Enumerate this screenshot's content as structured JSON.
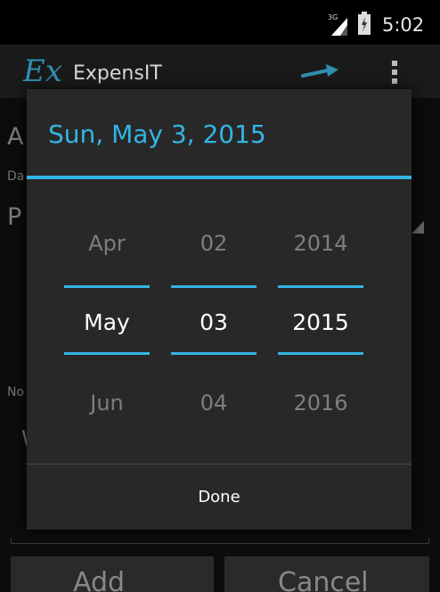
{
  "status_bar": {
    "network_label": "3G",
    "time": "5:02"
  },
  "action_bar": {
    "logo_text": "Ex",
    "app_title": "ExpensIT",
    "icons": [
      "send-icon",
      "overflow-menu-icon"
    ]
  },
  "background_form": {
    "field1_partial": "A",
    "field1_right_partial": ")",
    "label_date_partial": "Da",
    "field2_partial": "P",
    "label_notes_partial": "No",
    "notes_partial": "W",
    "button_left_partial": "Add",
    "button_right_partial": "Cancel"
  },
  "date_dialog": {
    "title": "Sun, May 3, 2015",
    "month": {
      "prev": "Apr",
      "current": "May",
      "next": "Jun"
    },
    "day": {
      "prev": "02",
      "current": "03",
      "next": "04"
    },
    "year": {
      "prev": "2014",
      "current": "2015",
      "next": "2016"
    },
    "done_label": "Done"
  },
  "colors": {
    "accent": "#33b5e5",
    "dialog_bg": "#282828",
    "action_bar_bg": "#1a1a1a"
  }
}
